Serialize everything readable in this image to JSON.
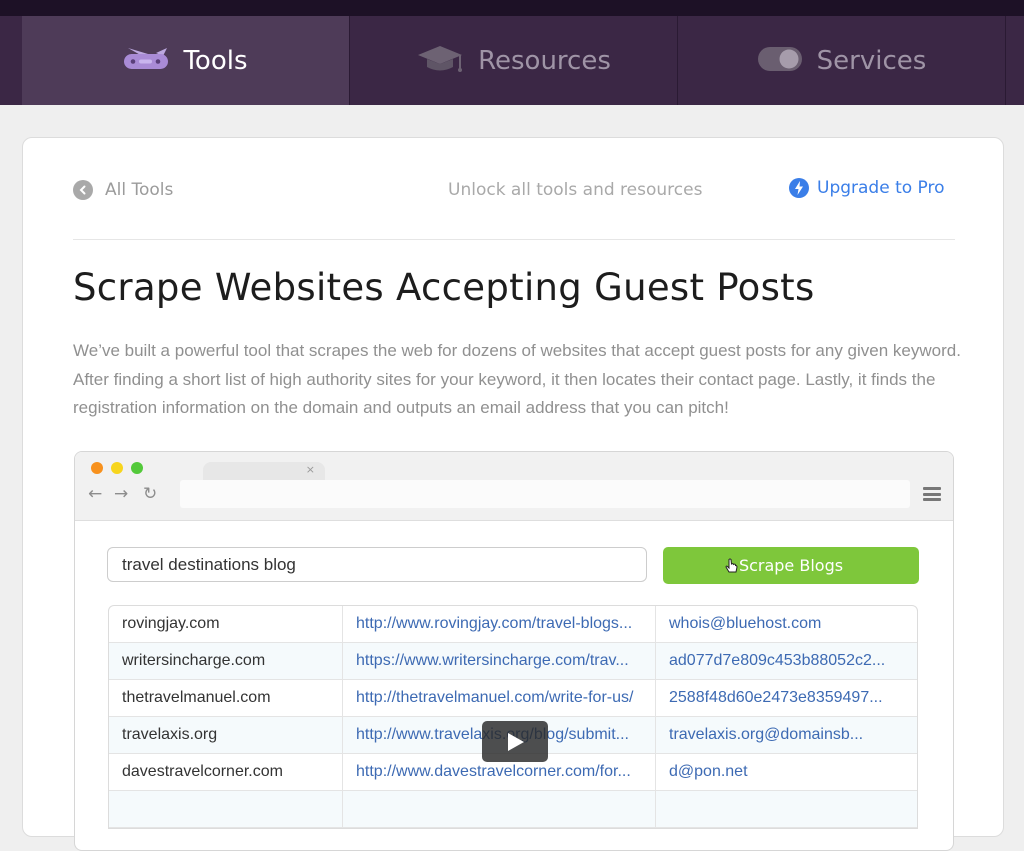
{
  "nav": {
    "tabs": [
      {
        "label": "Tools",
        "icon": "swiss-knife-icon",
        "active": true
      },
      {
        "label": "Resources",
        "icon": "graduation-cap-icon",
        "active": false
      },
      {
        "label": "Services",
        "icon": "toggle-icon",
        "active": false
      }
    ]
  },
  "header": {
    "back_label": "All Tools",
    "unlock_text": "Unlock all tools and resources",
    "upgrade_label": "Upgrade to Pro"
  },
  "page": {
    "title": "Scrape Websites Accepting Guest Posts",
    "description": "We’ve built a powerful tool that scrapes the web for dozens of websites that accept guest posts for any given keyword. After finding a short list of high authority sites for your keyword, it then locates their contact page. Lastly, it finds the registration information on the domain and outputs an email address that you can pitch!"
  },
  "demo": {
    "tab_close": "×",
    "search_value": "travel destinations blog",
    "scrape_button_label": "Scrape Blogs",
    "rows": [
      {
        "domain": "rovingjay.com",
        "url": "http://www.rovingjay.com/travel-blogs...",
        "email": "whois@bluehost.com"
      },
      {
        "domain": "writersincharge.com",
        "url": "https://www.writersincharge.com/trav...",
        "email": "ad077d7e809c453b88052c2..."
      },
      {
        "domain": "thetravelmanuel.com",
        "url": "http://thetravelmanuel.com/write-for-us/",
        "email": "2588f48d60e2473e8359497..."
      },
      {
        "domain": "travelaxis.org",
        "url": "http://www.travelaxis.org/blog/submit...",
        "email": "travelaxis.org@domainsb..."
      },
      {
        "domain": "davestravelcorner.com",
        "url": "http://www.davestravelcorner.com/for...",
        "email": "d@pon.net"
      },
      {
        "domain": "",
        "url": "",
        "email": ""
      }
    ]
  },
  "colors": {
    "nav_bg": "#3b2745",
    "nav_active_bg": "#4e3b58",
    "accent_blue": "#3a7ee8",
    "scrape_green": "#7ec73b",
    "link_blue": "#3d6ab3"
  }
}
